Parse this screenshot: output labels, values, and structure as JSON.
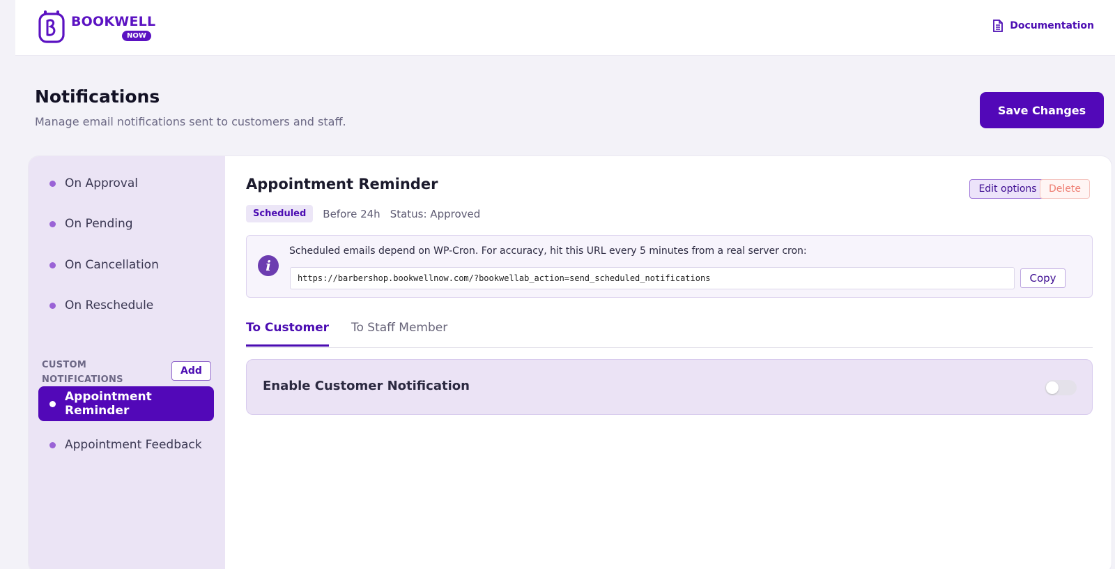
{
  "header": {
    "logo_word": "BOOKWELL",
    "logo_badge": "NOW",
    "doc_label": "Documentation"
  },
  "page": {
    "title": "Notifications",
    "subtitle": "Manage email notifications sent to customers and staff.",
    "save_label": "Save Changes"
  },
  "sidebar": {
    "items": [
      {
        "label": "On Approval"
      },
      {
        "label": "On Pending"
      },
      {
        "label": "On Cancellation"
      },
      {
        "label": "On Reschedule"
      }
    ],
    "custom_label": "CUSTOM NOTIFICATIONS",
    "add_label": "Add",
    "custom_items": [
      {
        "label": "Appointment Reminder",
        "active": true
      },
      {
        "label": "Appointment Feedback",
        "active": false
      }
    ]
  },
  "notification": {
    "title": "Appointment Reminder",
    "badge": "Scheduled",
    "timing": "Before 24h",
    "status": "Status: Approved",
    "edit_label": "Edit options",
    "delete_label": "Delete",
    "info_text": "Scheduled emails depend on WP-Cron. For accuracy, hit this URL every 5 minutes from a real server cron:",
    "cron_url": "https://barbershop.bookwellnow.com/?bookwellab_action=send_scheduled_notifications",
    "copy_label": "Copy",
    "tabs": [
      {
        "label": "To Customer",
        "active": true
      },
      {
        "label": "To Staff Member",
        "active": false
      }
    ],
    "enable_label": "Enable Customer Notification",
    "enable_on": false
  },
  "colors": {
    "accent": "#5208b8",
    "sidebar_bg": "#ebe4f5",
    "danger": "#ee7f74"
  },
  "icons": {
    "doc": "document-icon",
    "info": "info-icon",
    "bullet": "bullet-dot-icon"
  }
}
